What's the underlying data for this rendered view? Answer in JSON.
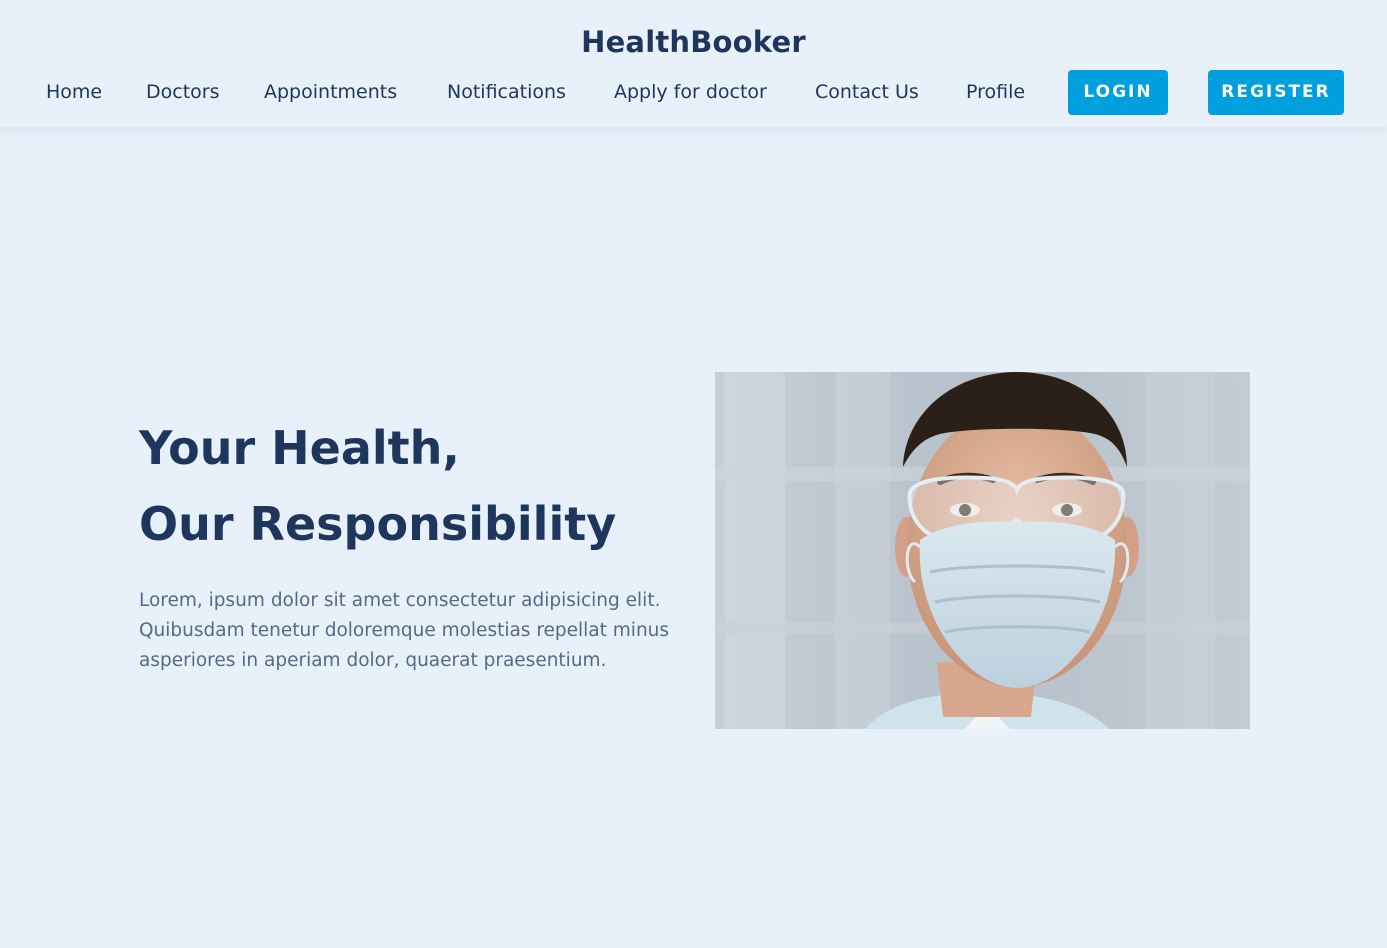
{
  "brand": "HealthBooker",
  "nav": {
    "items": [
      {
        "label": "Home"
      },
      {
        "label": "Doctors"
      },
      {
        "label": "Appointments"
      },
      {
        "label": "Notifications"
      },
      {
        "label": "Apply for doctor"
      },
      {
        "label": "Contact Us"
      },
      {
        "label": "Profile"
      }
    ],
    "login_label": "LOGIN",
    "register_label": "REGISTER"
  },
  "hero": {
    "title_line1": "Your Health,",
    "title_line2": "Our Responsibility",
    "text": "Lorem, ipsum dolor sit amet consectetur adipisicing elit. Quibusdam tenetur doloremque molestias repellat minus asperiores in aperiam dolor, quaerat praesentium."
  },
  "colors": {
    "background": "#e8f1fa",
    "primary_text": "#1e355c",
    "body_text": "#556a86",
    "accent": "#009fde"
  }
}
